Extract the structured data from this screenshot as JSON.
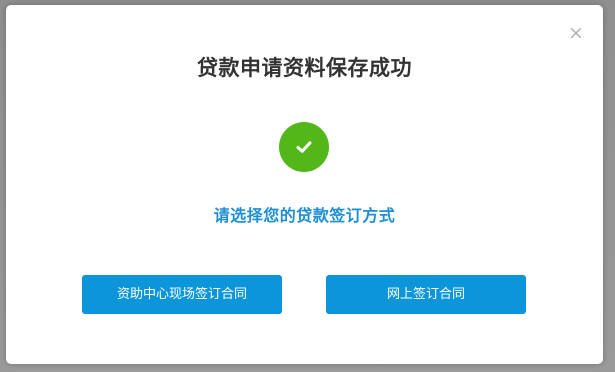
{
  "dialog": {
    "close_symbol": "×",
    "title": "贷款申请资料保存成功",
    "status_icon": "check-circle-icon",
    "subtitle": "请选择您的贷款签订方式",
    "buttons": {
      "center_sign_label": "资助中心现场签订合同",
      "online_sign_label": "网上签订合同"
    }
  },
  "colors": {
    "success_green": "#52b81a",
    "accent_blue": "#0c96d9",
    "subtitle_blue": "#1d8fd2",
    "title_text": "#333333"
  }
}
